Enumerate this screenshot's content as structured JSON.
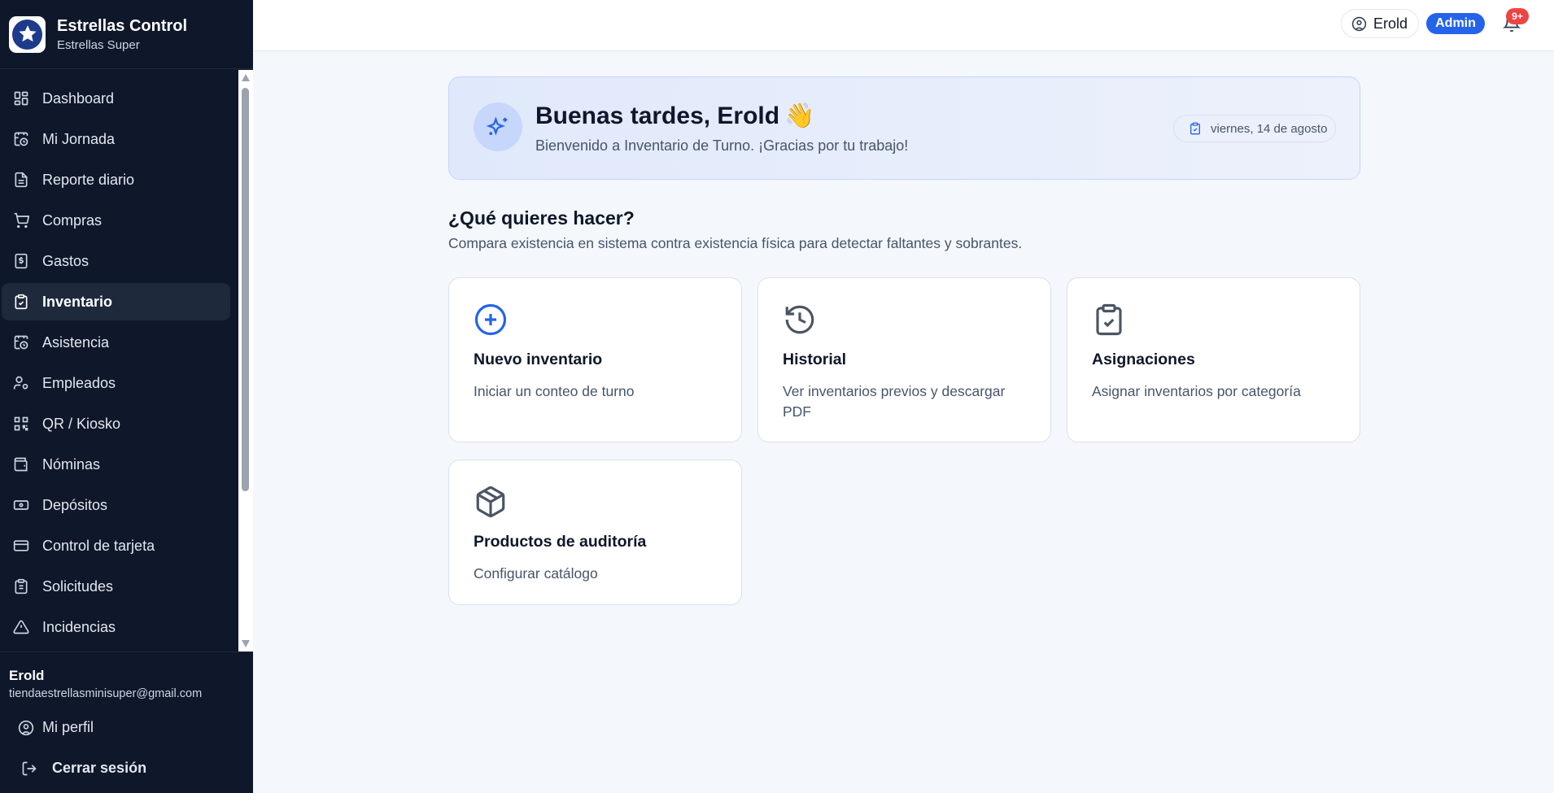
{
  "sidebar": {
    "brand_title": "Estrellas Control",
    "brand_subtitle": "Estrellas Super",
    "items": [
      {
        "label": "Dashboard",
        "icon": "dashboard-icon"
      },
      {
        "label": "Mi Jornada",
        "icon": "calendar-clock-icon"
      },
      {
        "label": "Reporte diario",
        "icon": "document-icon"
      },
      {
        "label": "Compras",
        "icon": "cart-icon"
      },
      {
        "label": "Gastos",
        "icon": "receipt-dollar-icon"
      },
      {
        "label": "Inventario",
        "icon": "clipboard-check-icon",
        "active": true
      },
      {
        "label": "Asistencia",
        "icon": "calendar-clock-icon"
      },
      {
        "label": "Empleados",
        "icon": "user-gear-icon"
      },
      {
        "label": "QR / Kiosko",
        "icon": "qr-icon"
      },
      {
        "label": "Nóminas",
        "icon": "wallet-icon"
      },
      {
        "label": "Depósitos",
        "icon": "banknote-icon"
      },
      {
        "label": "Control de tarjeta",
        "icon": "credit-card-icon"
      },
      {
        "label": "Solicitudes",
        "icon": "clipboard-list-icon"
      },
      {
        "label": "Incidencias",
        "icon": "warning-icon"
      }
    ],
    "user_name": "Erold",
    "user_email": "tiendaestrellasminisuper@gmail.com",
    "profile_label": "Mi perfil",
    "logout_label": "Cerrar sesión"
  },
  "topbar": {
    "user_label": "Erold",
    "role_badge": "Admin",
    "notification_count": "9+"
  },
  "welcome": {
    "greeting": "Buenas tardes, Erold",
    "emoji": "👋",
    "subtitle": "Bienvenido a Inventario de Turno. ¡Gracias por tu trabajo!",
    "date": "viernes, 14 de agosto"
  },
  "actions": {
    "title": "¿Qué quieres hacer?",
    "subtitle": "Compara existencia en sistema contra existencia física para detectar faltantes y sobrantes.",
    "cards": [
      {
        "title": "Nuevo inventario",
        "desc": "Iniciar un conteo de turno",
        "icon": "plus-circle-icon"
      },
      {
        "title": "Historial",
        "desc": "Ver inventarios previos y descargar PDF",
        "icon": "history-icon"
      },
      {
        "title": "Asignaciones",
        "desc": "Asignar inventarios por categoría",
        "icon": "clipboard-check-icon"
      },
      {
        "title": "Productos de auditoría",
        "desc": "Configurar catálogo",
        "icon": "box-icon"
      }
    ]
  },
  "colors": {
    "sidebar_bg": "#0f172a",
    "accent": "#2563eb",
    "badge_red": "#ef4444"
  }
}
